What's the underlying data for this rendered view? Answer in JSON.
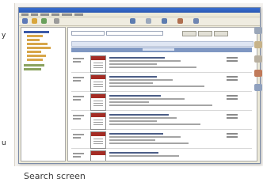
{
  "caption": "Search screen",
  "margin_letters": [
    "y",
    "u"
  ]
}
